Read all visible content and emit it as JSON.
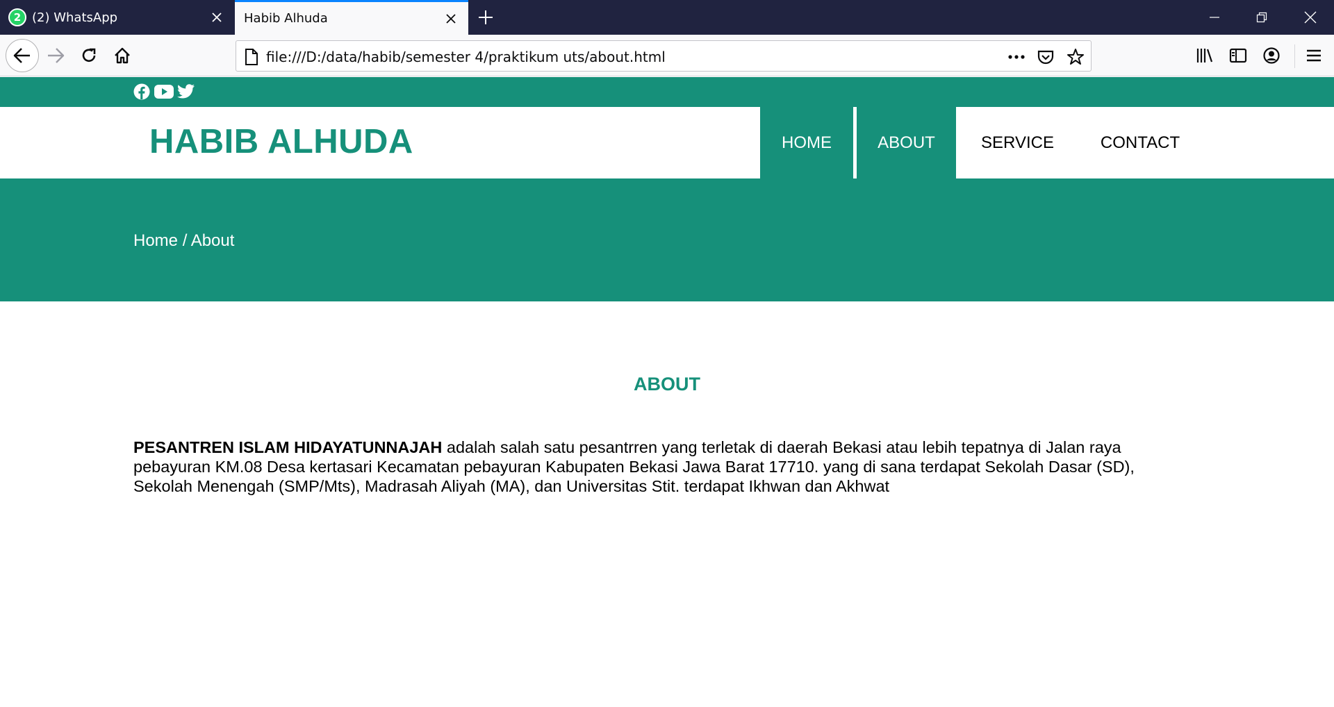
{
  "browser": {
    "tabs": [
      {
        "title": "(2) WhatsApp",
        "badge": "2",
        "favicon": "whatsapp-icon",
        "active": false
      },
      {
        "title": "Habib Alhuda",
        "active": true
      }
    ],
    "url": "file:///D:/data/habib/semester 4/praktikum uts/about.html",
    "accent": "#0a84ff"
  },
  "site": {
    "brand_color": "#16907a",
    "social_icons": [
      "facebook-icon",
      "youtube-icon",
      "twitter-icon"
    ],
    "brand": "HABIB ALHUDA",
    "menu": [
      {
        "label": "HOME",
        "active": true
      },
      {
        "label": "ABOUT",
        "active": true
      },
      {
        "label": "SERVICE",
        "active": false
      },
      {
        "label": "CONTACT",
        "active": false
      }
    ],
    "breadcrumb": "Home / About",
    "section_title": "ABOUT",
    "about": {
      "strong": "PESANTREN ISLAM HIDAYATUNNAJAH",
      "text": " adalah salah satu pesantrren yang terletak di daerah Bekasi atau lebih tepatnya di Jalan raya pebayuran KM.08 Desa kertasari Kecamatan pebayuran Kabupaten Bekasi Jawa Barat 17710. yang di sana terdapat Sekolah Dasar (SD), Sekolah Menengah (SMP/Mts), Madrasah Aliyah (MA), dan Universitas Stit. terdapat Ikhwan dan Akhwat"
    }
  }
}
